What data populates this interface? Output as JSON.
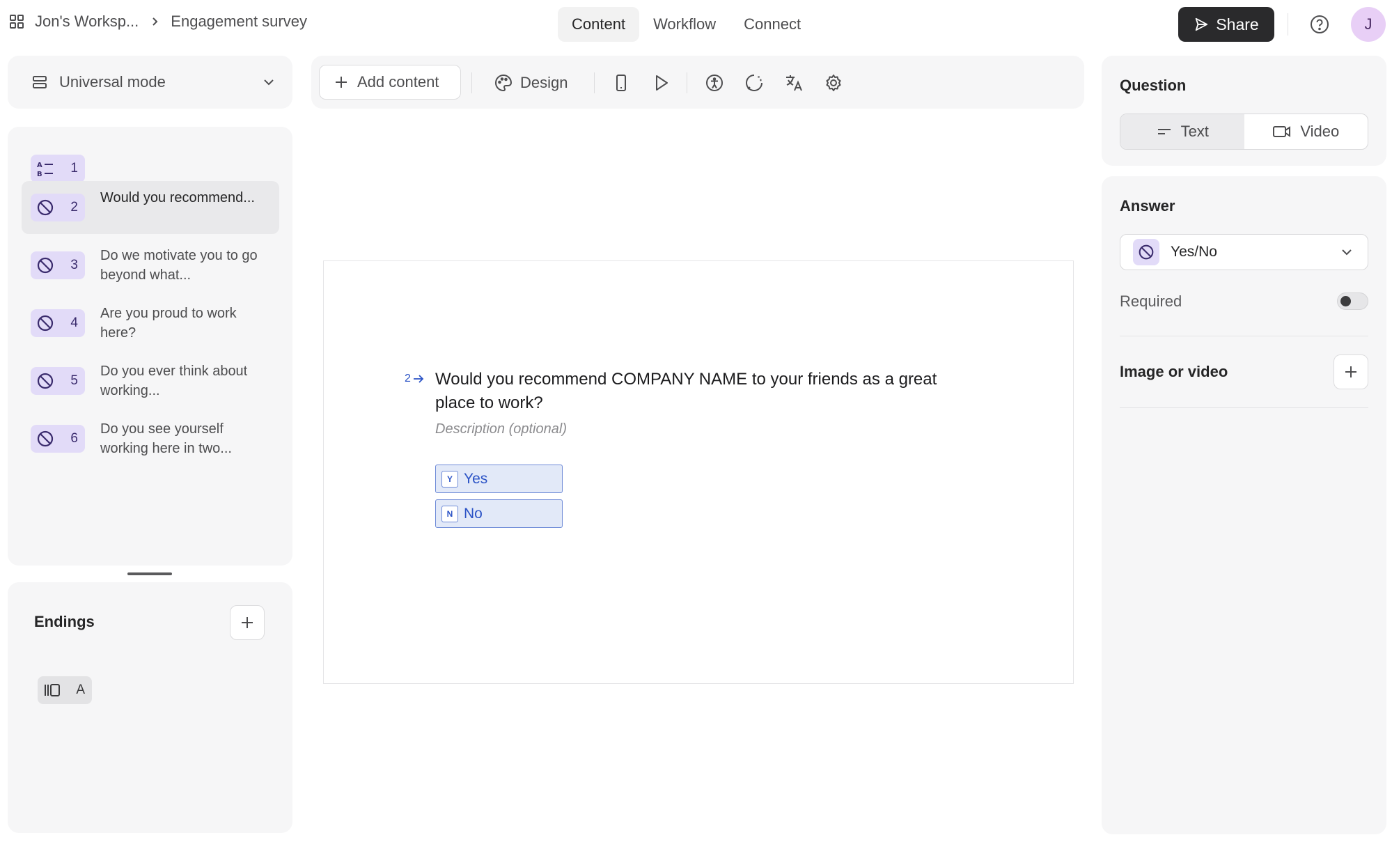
{
  "header": {
    "workspace": "Jon's Worksp...",
    "form_name": "Engagement survey",
    "tabs": [
      {
        "label": "Content",
        "active": true
      },
      {
        "label": "Workflow",
        "active": false
      },
      {
        "label": "Connect",
        "active": false
      }
    ],
    "share_label": "Share",
    "avatar_initial": "J"
  },
  "mode_select": {
    "label": "Universal mode"
  },
  "toolbar": {
    "add_content_label": "Add content",
    "design_label": "Design"
  },
  "questions": [
    {
      "number": "1",
      "text": "",
      "icon": "list-order-icon"
    },
    {
      "number": "2",
      "text": "Would you recommend...",
      "icon": "yes-no-icon",
      "selected": true
    },
    {
      "number": "3",
      "text": "Do we motivate you to go beyond what...",
      "icon": "yes-no-icon"
    },
    {
      "number": "4",
      "text": "Are you proud to work here?",
      "icon": "yes-no-icon"
    },
    {
      "number": "5",
      "text": "Do you ever think about working...",
      "icon": "yes-no-icon"
    },
    {
      "number": "6",
      "text": "Do you see yourself working here in two...",
      "icon": "yes-no-icon"
    }
  ],
  "endings": {
    "title": "Endings",
    "items": [
      {
        "label": "A"
      }
    ]
  },
  "canvas": {
    "question_number": "2",
    "question_title": "Would you recommend COMPANY NAME to your friends as a great place to work?",
    "description_placeholder": "Description (optional)",
    "choices": [
      {
        "key": "Y",
        "label": "Yes"
      },
      {
        "key": "N",
        "label": "No"
      }
    ]
  },
  "question_panel": {
    "title": "Question",
    "options": [
      {
        "label": "Text",
        "active": true
      },
      {
        "label": "Video",
        "active": false
      }
    ]
  },
  "answer_panel": {
    "title": "Answer",
    "answer_type": "Yes/No",
    "required_label": "Required",
    "required": false,
    "media_label": "Image or video"
  },
  "colors": {
    "accent_blue": "#2b53c6",
    "badge_purple": "#e2dbf8",
    "share_bg": "#2a2a2c",
    "avatar_bg": "#e8cff6"
  }
}
